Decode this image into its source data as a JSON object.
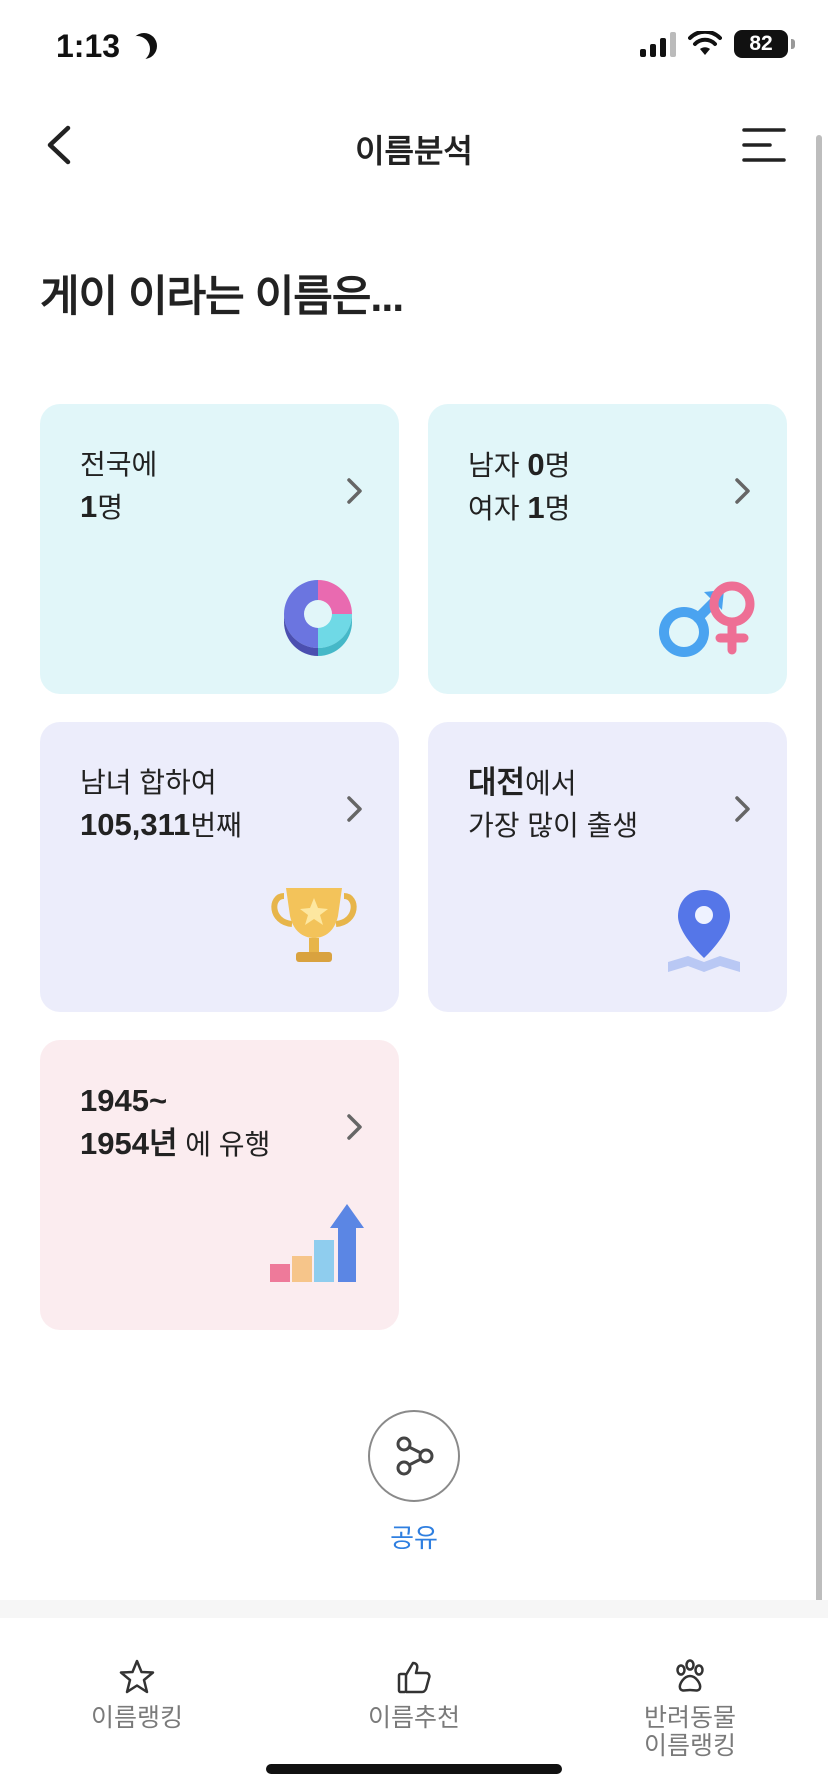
{
  "status_bar": {
    "time": "1:13",
    "battery": "82"
  },
  "header": {
    "title": "이름분석"
  },
  "headline": "게이 이라는 이름은...",
  "cards": {
    "national": {
      "line1": "전국에",
      "count": "1",
      "count_unit": "명"
    },
    "gender": {
      "male_label": "남자 ",
      "male_count": "0",
      "male_unit": "명",
      "female_label": "여자 ",
      "female_count": "1",
      "female_unit": "명"
    },
    "rank": {
      "line1": "남녀 합하여",
      "rank": "105,311",
      "rank_unit": "번째"
    },
    "region": {
      "region": "대전",
      "region_suffix": "에서",
      "line2": "가장 많이 출생"
    },
    "trend": {
      "line1": "1945~",
      "years": "1954년",
      "years_suffix": " 에 유행"
    }
  },
  "share": {
    "label": "공유"
  },
  "bottom_nav": {
    "items": [
      {
        "label": "이름랭킹",
        "icon": "star-icon"
      },
      {
        "label": "이름추천",
        "icon": "thumbs-up-icon"
      },
      {
        "label_line1": "반려동물",
        "label_line2": "이름랭킹",
        "icon": "paw-icon"
      }
    ]
  },
  "colors": {
    "accent": "#2f7fe0",
    "card_cyan": "#e1f6f9",
    "card_lavender": "#ecedfb",
    "card_pink": "#fbecef"
  }
}
